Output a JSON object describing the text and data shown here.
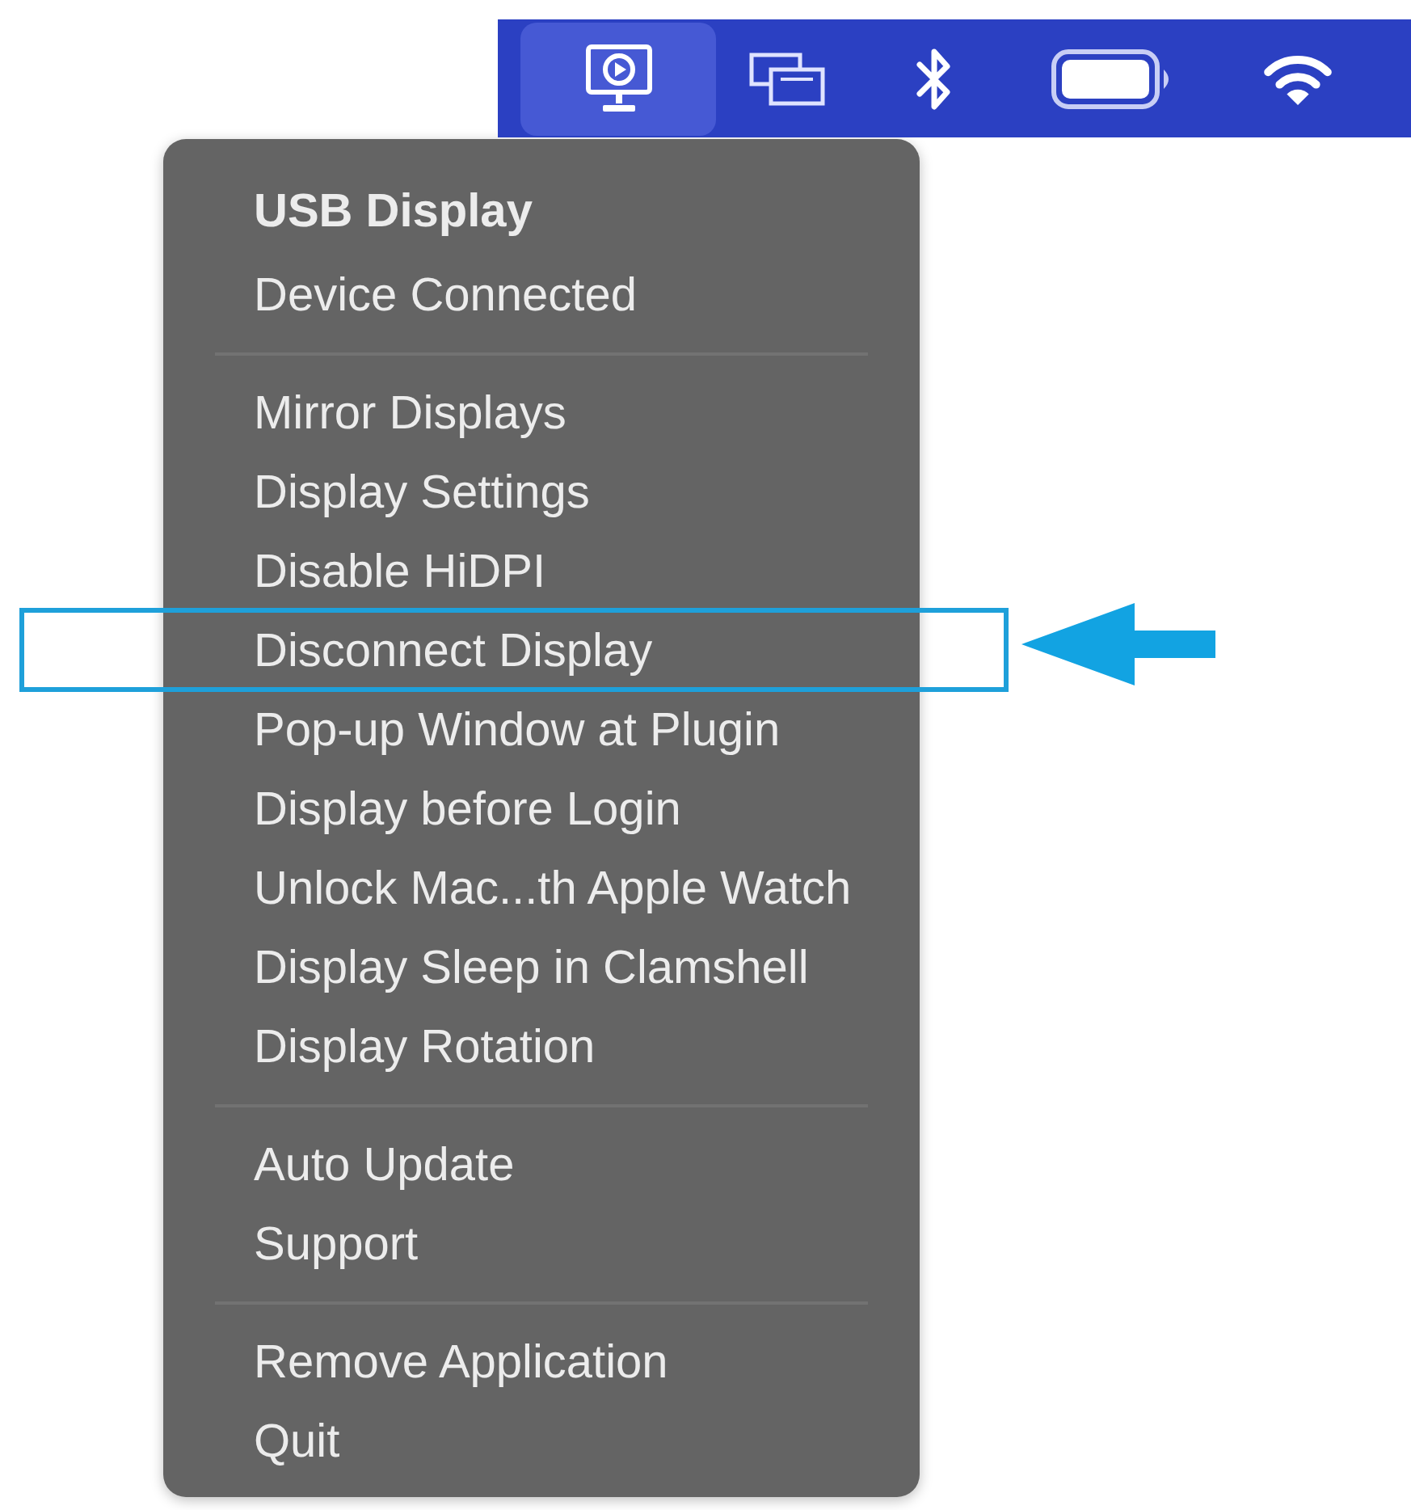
{
  "menu_bar": {
    "items": [
      {
        "kind": "display",
        "selected": true
      },
      {
        "kind": "windows",
        "selected": false
      },
      {
        "kind": "bluetooth",
        "selected": false
      },
      {
        "kind": "battery",
        "selected": false
      },
      {
        "kind": "wifi",
        "selected": false
      }
    ]
  },
  "menu": {
    "sections": [
      {
        "items": [
          {
            "kind": "title",
            "label": "USB Display",
            "callout": false
          },
          {
            "kind": "status",
            "label": "Device Connected",
            "callout": false
          }
        ]
      },
      {
        "items": [
          {
            "kind": "action",
            "label": "Mirror Displays",
            "callout": false
          },
          {
            "kind": "action",
            "label": "Display Settings",
            "callout": false
          },
          {
            "kind": "action",
            "label": "Disable HiDPI",
            "callout": false
          },
          {
            "kind": "action",
            "label": "Disconnect Display",
            "callout": true
          },
          {
            "kind": "action",
            "label": "Pop-up Window at Plugin",
            "callout": false
          },
          {
            "kind": "action",
            "label": "Display before Login",
            "callout": false
          },
          {
            "kind": "action",
            "label": "Unlock Mac...th Apple Watch",
            "callout": false
          },
          {
            "kind": "action",
            "label": "Display Sleep in Clamshell",
            "callout": false
          },
          {
            "kind": "action",
            "label": "Display Rotation",
            "callout": false
          }
        ]
      },
      {
        "items": [
          {
            "kind": "action",
            "label": "Auto Update",
            "callout": false
          },
          {
            "kind": "action",
            "label": "Support",
            "callout": false
          }
        ]
      },
      {
        "items": [
          {
            "kind": "action",
            "label": "Remove Application",
            "callout": false
          },
          {
            "kind": "action",
            "label": "Quit",
            "callout": false
          }
        ]
      }
    ]
  }
}
